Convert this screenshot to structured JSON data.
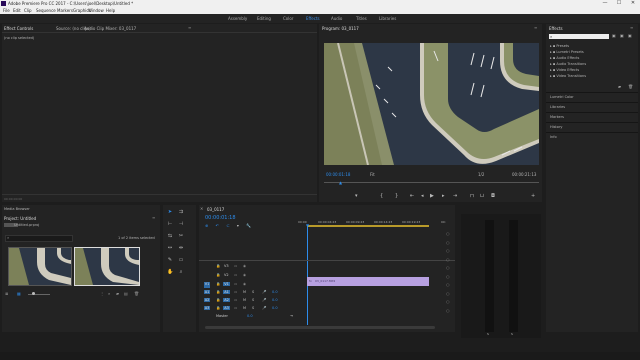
{
  "window": {
    "title": "Adobe Premiere Pro CC 2017 - C:\\Users\\joel\\Desktop\\Untitled *",
    "min": "—",
    "max": "☐",
    "close": "✕"
  },
  "menu": [
    "File",
    "Edit",
    "Clip",
    "Sequence",
    "Markers",
    "Graphics",
    "Window",
    "Help"
  ],
  "workspaces": [
    "Assembly",
    "Editing",
    "Color",
    "Effects",
    "Audio",
    "Titles",
    "Libraries"
  ],
  "workspace_active": "Effects",
  "source_panel": {
    "tabs": [
      "Effect Controls",
      "Source: (no clips)",
      "Audio Clip Mixer: 03_0117"
    ],
    "body_text": "(no clip selected)",
    "footer_time": "00:00:00:00"
  },
  "program": {
    "tab": "Program: 03_0117",
    "timecode": "00:00:01:18",
    "fit": "Fit",
    "quality": "1/2",
    "duration": "00:00:21:13"
  },
  "effects_panel": {
    "tab": "Effects",
    "search_value": "",
    "items": [
      "Presets",
      "Lumetri Presets",
      "Audio Effects",
      "Audio Transitions",
      "Video Effects",
      "Video Transitions"
    ],
    "collapsed": [
      "Lumetri Color",
      "Libraries",
      "Markers",
      "History",
      "Info"
    ]
  },
  "project": {
    "tabs": [
      "Media Browser",
      "Project: Untitled"
    ],
    "file": "Untitled.prproj",
    "selection": "1 of 2 items selected",
    "search_placeholder": ""
  },
  "timeline": {
    "tab": "03_0117",
    "timecode": "00:00:01:18",
    "ruler": [
      "00:00",
      "00:00:04:23",
      "00:00:09:23",
      "00:00:14:23",
      "00:00:19:23",
      "00:"
    ],
    "video_tracks": [
      "V3",
      "V2",
      "V1"
    ],
    "audio_tracks": [
      "A1",
      "A2",
      "A3"
    ],
    "master": "Master",
    "master_value": "0.0",
    "audio_values": [
      "0.0",
      "0.0",
      "0.0"
    ],
    "clip_label": "03_0117.MP4"
  },
  "meter": {
    "labels": [
      "S",
      "S"
    ]
  },
  "colors": {
    "accent": "#2d8ceb",
    "clip": "#b7a0e0",
    "panel": "#232323"
  }
}
